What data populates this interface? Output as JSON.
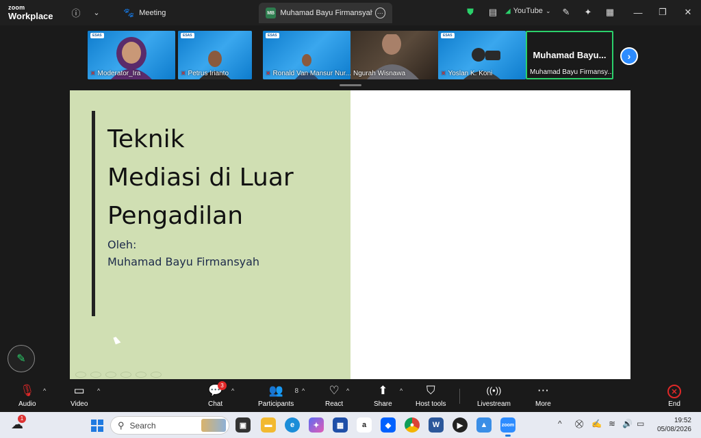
{
  "titlebar": {
    "logo_line1": "zoom",
    "logo_line2": "Workplace",
    "meeting_tab": "Meeting",
    "share_badge": "MB",
    "share_tab": "Muhamad Bayu Firmansyah's scre",
    "youtube_label": "YouTube"
  },
  "gallery": {
    "tiles": [
      {
        "name": "Moderator_Ira"
      },
      {
        "name": "Petrus Irianto"
      },
      {
        "name": "Ronald Van Mansur Nur..."
      },
      {
        "name": "Ngurah Wisnawa"
      },
      {
        "name": "Yoslan K. Koni"
      },
      {
        "name": "Muhamad Bayu Firmansy...",
        "big_name": "Muhamad  Bayu..."
      }
    ],
    "esas_label": "ESAS"
  },
  "slide": {
    "title_lines": [
      "Teknik",
      "Mediasi di Luar",
      "Pengadilan"
    ],
    "by_label": "Oleh:",
    "author": "Muhamad Bayu Firmansyah"
  },
  "toolbar": {
    "audio": "Audio",
    "video": "Video",
    "chat": "Chat",
    "chat_badge": "3",
    "participants": "Participants",
    "participants_count": "8",
    "react": "React",
    "share": "Share",
    "host_tools": "Host tools",
    "livestream": "Livestream",
    "more": "More",
    "end": "End"
  },
  "taskbar": {
    "weather_badge": "1",
    "search_placeholder": "Search",
    "time": "19:52",
    "date": "05/08/2026"
  },
  "colors": {
    "accent": "#2d8cff",
    "active_green": "#2bd16b",
    "end_red": "#e02828",
    "slide_left": "#d0dfb3"
  }
}
